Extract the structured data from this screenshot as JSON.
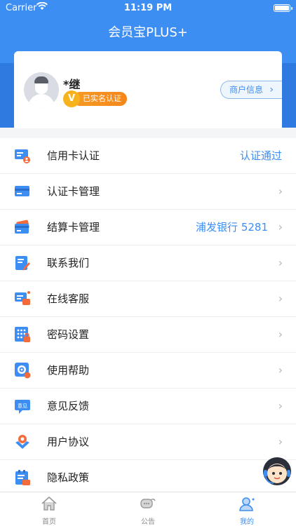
{
  "status_bar": {
    "carrier": "Carrier",
    "time": "11:19 PM"
  },
  "app_title": "会员宝PLUS+",
  "profile": {
    "name": "*继",
    "verified_icon": "V",
    "verified_label": "已实名认证",
    "merchant_button": "商户信息"
  },
  "menu": [
    {
      "label": "信用卡认证",
      "value": "认证通过",
      "icon": "credit-card-verify-icon"
    },
    {
      "label": "认证卡管理",
      "value": "",
      "icon": "card-management-icon"
    },
    {
      "label": "结算卡管理",
      "value": "浦发银行 5281",
      "icon": "settlement-card-icon"
    },
    {
      "label": "联系我们",
      "value": "",
      "icon": "contact-icon"
    },
    {
      "label": "在线客服",
      "value": "",
      "icon": "online-service-icon"
    },
    {
      "label": "密码设置",
      "value": "",
      "icon": "password-keypad-icon"
    },
    {
      "label": "使用帮助",
      "value": "",
      "icon": "help-icon"
    },
    {
      "label": "意见反馈",
      "value": "",
      "icon": "feedback-icon"
    },
    {
      "label": "用户协议",
      "value": "",
      "icon": "agreement-icon"
    },
    {
      "label": "隐私政策",
      "value": "",
      "icon": "privacy-icon"
    }
  ],
  "tabbar": [
    {
      "label": "首页",
      "icon": "home-icon"
    },
    {
      "label": "公告",
      "icon": "announcement-icon"
    },
    {
      "label": "我的",
      "icon": "profile-icon"
    }
  ],
  "colors": {
    "primary": "#3d8ef3",
    "badge_orange": "#f4871a",
    "icon_red": "#f26b3a"
  }
}
